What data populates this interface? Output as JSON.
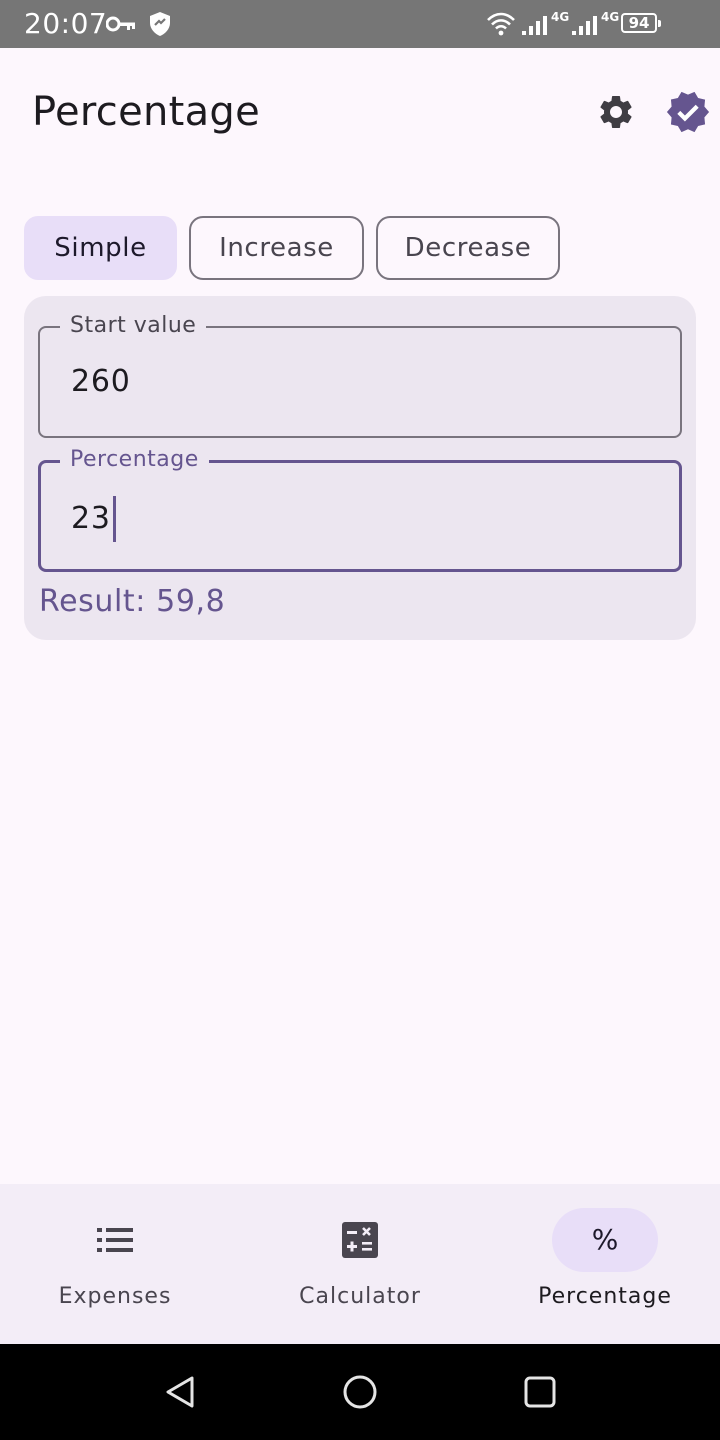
{
  "status_bar": {
    "time": "20:07",
    "network_1": "4G",
    "network_2": "4G",
    "battery": "94"
  },
  "header": {
    "title": "Percentage",
    "settings_icon": "gear-icon",
    "verified_icon": "verified-badge-icon"
  },
  "colors": {
    "primary": "#65558f",
    "secondary_container": "#e8def8",
    "surface": "#fdf7fd",
    "card": "#ece6f0",
    "nav_bar": "#f3edf7"
  },
  "segments": [
    {
      "label": "Simple",
      "selected": true
    },
    {
      "label": "Increase",
      "selected": false
    },
    {
      "label": "Decrease",
      "selected": false
    }
  ],
  "form": {
    "start_value": {
      "label": "Start value",
      "value": "260"
    },
    "percentage": {
      "label": "Percentage",
      "value": "23",
      "focused": true
    },
    "result": "Result: 59,8"
  },
  "bottom_nav": {
    "items": [
      {
        "label": "Expenses",
        "icon": "list-icon",
        "active": false
      },
      {
        "label": "Calculator",
        "icon": "calculator-icon",
        "active": false
      },
      {
        "label": "Percentage",
        "icon": "percent-icon",
        "glyph": "%",
        "active": true
      }
    ]
  },
  "system_nav": {
    "back_icon": "back-triangle-icon",
    "home_icon": "home-circle-icon",
    "recents_icon": "recents-square-icon"
  }
}
